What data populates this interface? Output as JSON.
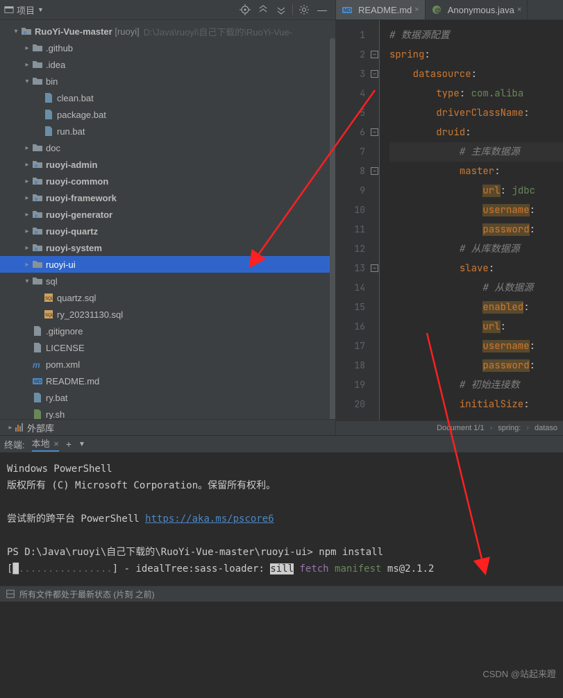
{
  "toolbar": {
    "project_label": "项目",
    "icons": [
      "target-icon",
      "expand-icon",
      "collapse-icon",
      "gear-icon",
      "hide-icon"
    ]
  },
  "tree": {
    "root": {
      "name": "RuoYi-Vue-master",
      "bracket": "[ruoyi]",
      "path": "D:\\Java\\ruoyi\\自己下载的\\RuoYi-Vue-"
    },
    "items": [
      {
        "depth": 1,
        "arr": "▾",
        "icon": "module",
        "nameKey": "tree.root.name",
        "bold": true,
        "isRoot": true
      },
      {
        "depth": 2,
        "arr": "▸",
        "icon": "folder",
        "name": ".github"
      },
      {
        "depth": 2,
        "arr": "▸",
        "icon": "folder",
        "name": ".idea"
      },
      {
        "depth": 2,
        "arr": "▾",
        "icon": "folder",
        "name": "bin"
      },
      {
        "depth": 3,
        "arr": "",
        "icon": "bat",
        "name": "clean.bat"
      },
      {
        "depth": 3,
        "arr": "",
        "icon": "bat",
        "name": "package.bat"
      },
      {
        "depth": 3,
        "arr": "",
        "icon": "bat",
        "name": "run.bat"
      },
      {
        "depth": 2,
        "arr": "▸",
        "icon": "folder",
        "name": "doc"
      },
      {
        "depth": 2,
        "arr": "▸",
        "icon": "module",
        "name": "ruoyi-admin",
        "bold": true
      },
      {
        "depth": 2,
        "arr": "▸",
        "icon": "module",
        "name": "ruoyi-common",
        "bold": true
      },
      {
        "depth": 2,
        "arr": "▸",
        "icon": "module",
        "name": "ruoyi-framework",
        "bold": true
      },
      {
        "depth": 2,
        "arr": "▸",
        "icon": "module",
        "name": "ruoyi-generator",
        "bold": true
      },
      {
        "depth": 2,
        "arr": "▸",
        "icon": "module",
        "name": "ruoyi-quartz",
        "bold": true
      },
      {
        "depth": 2,
        "arr": "▸",
        "icon": "module",
        "name": "ruoyi-system",
        "bold": true
      },
      {
        "depth": 2,
        "arr": "▸",
        "icon": "folder",
        "name": "ruoyi-ui",
        "selected": true
      },
      {
        "depth": 2,
        "arr": "▾",
        "icon": "folder",
        "name": "sql"
      },
      {
        "depth": 3,
        "arr": "",
        "icon": "sql",
        "name": "quartz.sql"
      },
      {
        "depth": 3,
        "arr": "",
        "icon": "sql",
        "name": "ry_20231130.sql"
      },
      {
        "depth": 2,
        "arr": "",
        "icon": "file",
        "name": ".gitignore"
      },
      {
        "depth": 2,
        "arr": "",
        "icon": "file",
        "name": "LICENSE"
      },
      {
        "depth": 2,
        "arr": "",
        "icon": "maven",
        "name": "pom.xml"
      },
      {
        "depth": 2,
        "arr": "",
        "icon": "md",
        "name": "README.md"
      },
      {
        "depth": 2,
        "arr": "",
        "icon": "bat",
        "name": "ry.bat"
      },
      {
        "depth": 2,
        "arr": "",
        "icon": "sh",
        "name": "ry.sh"
      }
    ],
    "ext_lib": "外部库"
  },
  "editor": {
    "tabs": [
      {
        "icon": "md",
        "label": "README.md",
        "active": true
      },
      {
        "icon": "java",
        "label": "Anonymous.java",
        "active": false
      }
    ],
    "lines": [
      {
        "n": 1,
        "html": "<span class='c'># 数据源配置</span>"
      },
      {
        "n": 2,
        "html": "<span class='k'>spring</span>:"
      },
      {
        "n": 3,
        "html": "    <span class='k'>datasource</span>:"
      },
      {
        "n": 4,
        "html": "        <span class='k'>type</span>: <span class='v'>com.aliba</span>"
      },
      {
        "n": 5,
        "html": "        <span class='k'>driverClassName</span>:"
      },
      {
        "n": 6,
        "html": "        <span class='k'>druid</span>:"
      },
      {
        "n": 7,
        "html": "            <span class='c'># 主库数据源</span>",
        "cur": true
      },
      {
        "n": 8,
        "html": "            <span class='k'>master</span>:"
      },
      {
        "n": 9,
        "html": "                <span class='k hl'>url</span>: <span class='v'>jdbc</span>"
      },
      {
        "n": 10,
        "html": "                <span class='k hl'>username</span>:"
      },
      {
        "n": 11,
        "html": "                <span class='k hl'>password</span>:"
      },
      {
        "n": 12,
        "html": "            <span class='c'># 从库数据源</span>"
      },
      {
        "n": 13,
        "html": "            <span class='k'>slave</span>:"
      },
      {
        "n": 14,
        "html": "                <span class='c'># 从数据源</span>"
      },
      {
        "n": 15,
        "html": "                <span class='k hl'>enabled</span>:"
      },
      {
        "n": 16,
        "html": "                <span class='k hl'>url</span>:"
      },
      {
        "n": 17,
        "html": "                <span class='k hl'>username</span>:"
      },
      {
        "n": 18,
        "html": "                <span class='k hl'>password</span>:"
      },
      {
        "n": 19,
        "html": "            <span class='c'># 初始连接数</span>"
      },
      {
        "n": 20,
        "html": "            <span class='k'>initialSize</span>:"
      }
    ],
    "crumbs": [
      "Document 1/1",
      "spring:",
      "dataso"
    ]
  },
  "terminal": {
    "header": "终端:",
    "tab": "本地",
    "lines": {
      "l1": "Windows PowerShell",
      "l2": "版权所有 (C) Microsoft Corporation。保留所有权利。",
      "l3a": "尝试新的跨平台 PowerShell ",
      "l3b": "https://aka.ms/pscore6",
      "l4a": "PS D:\\Java\\ruoyi\\自己下载的\\RuoYi-Vue-master\\ruoyi-ui> ",
      "l4b": "npm install",
      "l5a": "[",
      "l5b": "█",
      "l5c": "................",
      "l5d": "] - idealTree:sass-loader: ",
      "l5e": "sill",
      "l5f": " fetch",
      "l5g": " manifest",
      "l5h": " ms@2.1.2"
    }
  },
  "status": {
    "left": "所有文件都处于最新状态 (片刻 之前)"
  },
  "watermark": "CSDN @站起来蹬"
}
